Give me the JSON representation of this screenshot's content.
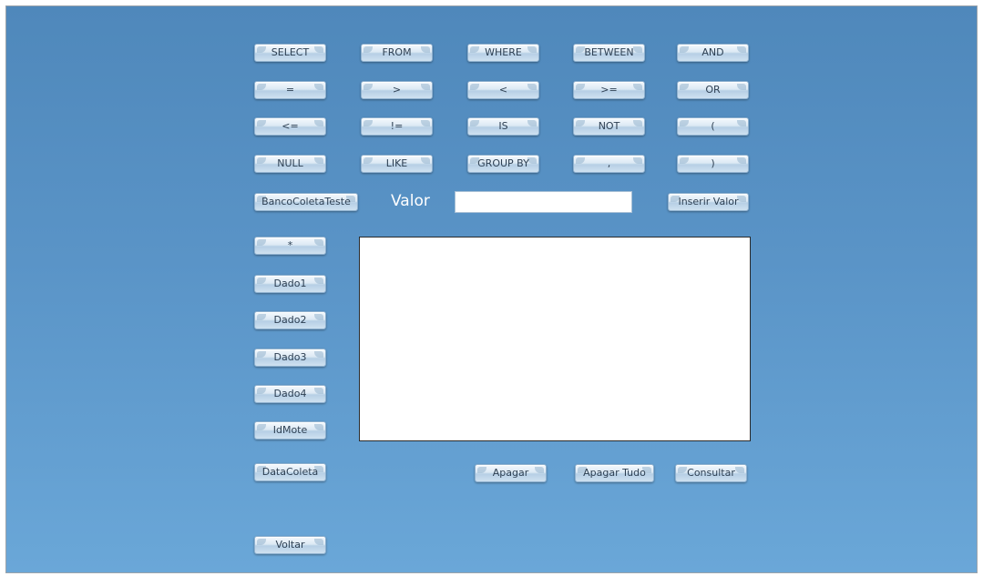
{
  "keywords": {
    "select": "SELECT",
    "from": "FROM",
    "where": "WHERE",
    "between": "BETWEEN",
    "and": "AND",
    "equals": "=",
    "greater": ">",
    "less": "<",
    "greater_equal": ">=",
    "or": "OR",
    "less_equal": "<=",
    "not_equal": "!=",
    "is": "IS",
    "not": "NOT",
    "open_paren": "(",
    "null": "NULL",
    "like": "LIKE",
    "group_by": "GROUP BY",
    "comma": ",",
    "close_paren": ")"
  },
  "table_button": "BancoColetaTeste",
  "valor": {
    "label": "Valor",
    "value": "",
    "insert_button": "Inserir Valor"
  },
  "columns": {
    "all": "*",
    "dado1": "Dado1",
    "dado2": "Dado2",
    "dado3": "Dado3",
    "dado4": "Dado4",
    "idmote": "IdMote",
    "datacoleta": "DataColeta"
  },
  "query_text": "",
  "actions": {
    "apagar": "Apagar",
    "apagar_tudo": "Apagar Tudo",
    "consultar": "Consultar",
    "voltar": "Voltar"
  }
}
